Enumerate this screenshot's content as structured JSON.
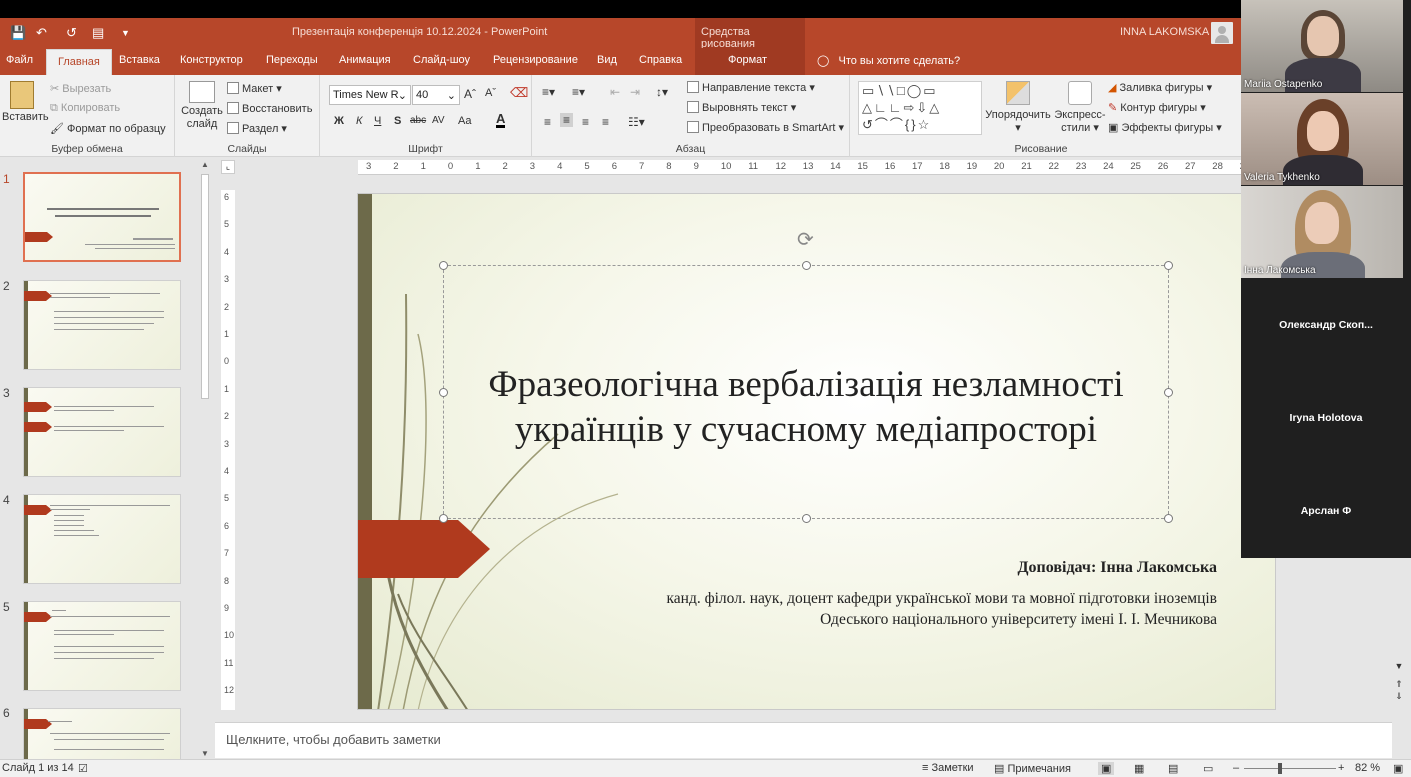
{
  "window": {
    "title": "Презентація конференція 10.12.2024  -  PowerPoint",
    "contextual_group": "Средства рисования",
    "user_name": "INNA LAKOMSKA"
  },
  "tabs": [
    "Файл",
    "Главная",
    "Вставка",
    "Конструктор",
    "Переходы",
    "Анимация",
    "Слайд-шоу",
    "Рецензирование",
    "Вид",
    "Справка",
    "Формат"
  ],
  "active_tab": "Главная",
  "tell_me": "Что вы хотите сделать?",
  "ribbon": {
    "clipboard": {
      "paste": "Вставить",
      "cut": "Вырезать",
      "copy": "Копировать",
      "format_painter": "Формат по образцу",
      "label": "Буфер обмена"
    },
    "slides": {
      "new_slide_line1": "Создать",
      "new_slide_line2": "слайд",
      "layout": "Макет",
      "reset": "Восстановить",
      "section": "Раздел",
      "label": "Слайды"
    },
    "font": {
      "name": "Times New R",
      "size": "40",
      "bold": "Ж",
      "italic": "К",
      "underline": "Ч",
      "shadow": "S",
      "strike": "abc",
      "spacing": "AV",
      "case": "Aa",
      "color": "A",
      "label": "Шрифт"
    },
    "paragraph": {
      "text_direction": "Направление текста",
      "align_text": "Выровнять текст",
      "smartart": "Преобразовать в SmartArt",
      "label": "Абзац"
    },
    "drawing": {
      "arrange": "Упорядочить",
      "quick_styles_line1": "Экспресс-",
      "quick_styles_line2": "стили",
      "fill": "Заливка фигуры",
      "outline": "Контур фигуры",
      "effects": "Эффекты фигуры",
      "label": "Рисование"
    }
  },
  "ruler": {
    "horizontal": [
      "3",
      "2",
      "1",
      "0",
      "1",
      "2",
      "3",
      "4",
      "5",
      "6",
      "7",
      "8",
      "9",
      "10",
      "11",
      "12",
      "13",
      "14",
      "15",
      "16",
      "17",
      "18",
      "19",
      "20",
      "21",
      "22",
      "23",
      "24",
      "25",
      "26",
      "27",
      "28",
      "29"
    ],
    "vertical": [
      "6",
      "5",
      "4",
      "3",
      "2",
      "1",
      "0",
      "1",
      "2",
      "3",
      "4",
      "5",
      "6",
      "7",
      "8",
      "9",
      "10",
      "11",
      "12"
    ]
  },
  "thumbnails": [
    {
      "num": "1",
      "selected": true
    },
    {
      "num": "2",
      "selected": false
    },
    {
      "num": "3",
      "selected": false
    },
    {
      "num": "4",
      "selected": false
    },
    {
      "num": "5",
      "selected": false
    },
    {
      "num": "6",
      "selected": false
    }
  ],
  "slide": {
    "title_line1": "Фразеологічна вербалізація незламності",
    "title_line2": "українців у сучасному медіапросторі",
    "speaker": "Доповідач: Інна Лакомська",
    "affiliation_line1": "канд. філол. наук, доцент кафедри української мови та мовної підготовки іноземців",
    "affiliation_line2": "Одеського національного університету імені І. І. Мечникова",
    "accent_color": "#b03a1e",
    "bar_color": "#6d6a4a"
  },
  "notes_placeholder": "Щелкните, чтобы добавить заметки",
  "status": {
    "slide_counter": "Слайд 1 из 14",
    "notes": "Заметки",
    "comments": "Примечания",
    "zoom": "82 %"
  },
  "participants": [
    {
      "name": "Mariia Ostapenko",
      "video": true
    },
    {
      "name": "Valeria Tykhenko",
      "video": true
    },
    {
      "name": "Інна  Лакомська",
      "video": true
    },
    {
      "name": "Олександр  Скоп...",
      "video": false
    },
    {
      "name": "Iryna Holotova",
      "video": false
    },
    {
      "name": "Арслан Ф",
      "video": false
    }
  ],
  "colors": {
    "ribbon_brand": "#b7472a",
    "contextual": "#a03a22",
    "video_panel": "#1f1f1f"
  }
}
